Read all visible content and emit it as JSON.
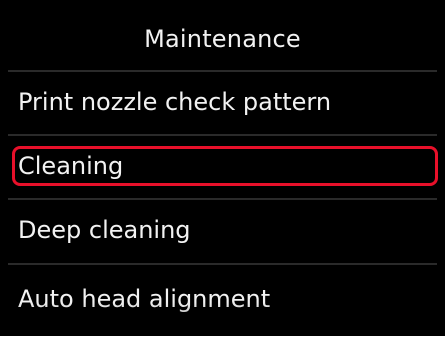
{
  "screen": {
    "title": "Maintenance"
  },
  "menu": {
    "items": [
      {
        "label": "Print nozzle check pattern"
      },
      {
        "label": "Cleaning"
      },
      {
        "label": "Deep cleaning"
      },
      {
        "label": "Auto head alignment"
      }
    ]
  },
  "colors": {
    "background": "#000000",
    "text": "#f2f2f2",
    "selection": "#e8102a"
  }
}
